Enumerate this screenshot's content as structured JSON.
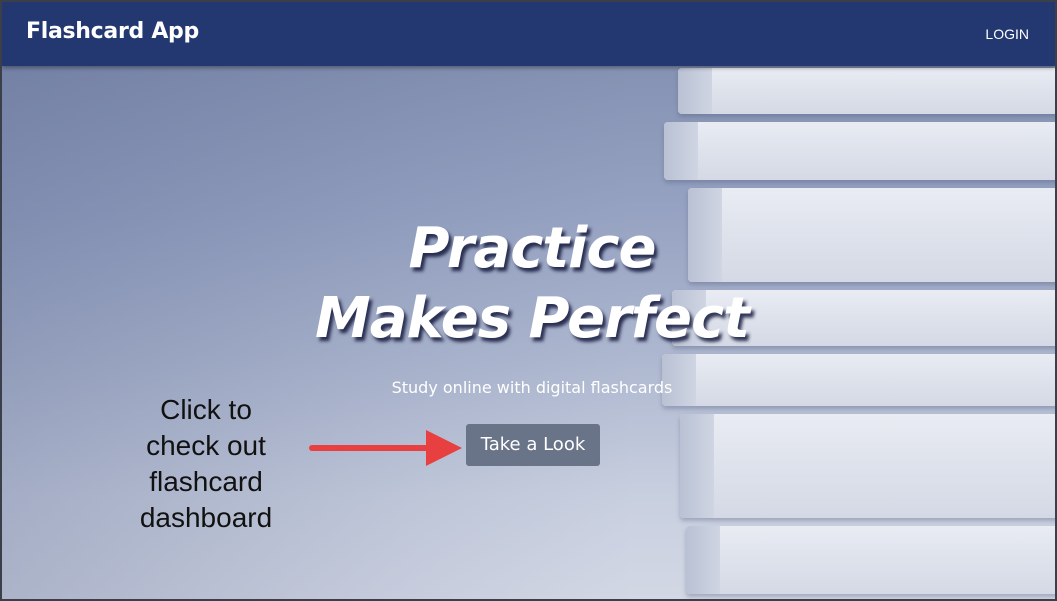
{
  "nav": {
    "brand": "Flashcard App",
    "login_label": "LOGIN"
  },
  "hero": {
    "headline_line1": "Practice",
    "headline_line2": "Makes Perfect",
    "subtitle": "Study online with digital flashcards",
    "cta_label": "Take a Look"
  },
  "annotation": {
    "line1": "Click to",
    "line2": "check out",
    "line3": "flashcard",
    "line4": "dashboard",
    "arrow_color": "#e84040"
  },
  "colors": {
    "navbar": "#233771",
    "cta": "#6a7488",
    "text_light": "#ffffff"
  }
}
